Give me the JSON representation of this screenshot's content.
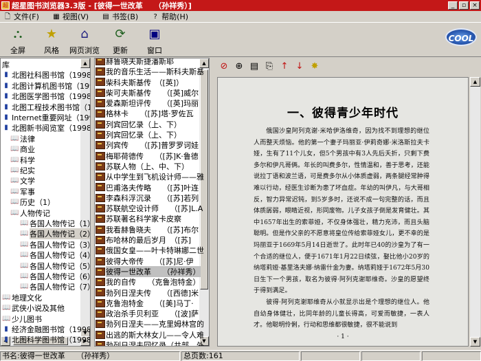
{
  "window": {
    "title": "超星图书浏览器3.3版 - [彼得一世改革　　（孙祥秀）]",
    "app_icon": "超",
    "min": "_",
    "restore": "▫",
    "close": "×"
  },
  "menu": [
    {
      "label": "文件(F)",
      "icon": "file-icon",
      "glyph": "🗋"
    },
    {
      "label": "视图(V)",
      "icon": "view-icon",
      "glyph": "▦"
    },
    {
      "label": "书签(B)",
      "icon": "bookmark-icon",
      "glyph": "▤"
    },
    {
      "label": "帮助(H)",
      "icon": "help-icon",
      "glyph": "?"
    }
  ],
  "toolbar": [
    {
      "label": "全屏",
      "icon": "fullscreen-icon",
      "glyph": "⛬",
      "color": "#206020"
    },
    {
      "label": "风格",
      "icon": "style-icon",
      "glyph": "★",
      "color": "#c0a000"
    },
    {
      "label": "网页浏览",
      "icon": "home-icon",
      "glyph": "⌂",
      "color": "#202080"
    },
    {
      "label": "更新",
      "icon": "update-icon",
      "glyph": "⟳",
      "color": "#206020"
    },
    {
      "label": "窗口",
      "icon": "window-icon",
      "glyph": "▣",
      "color": "#000080"
    }
  ],
  "logo": "COOL",
  "tree": [
    {
      "label": "库",
      "indent": 0,
      "icon": "none",
      "glyph": ""
    },
    {
      "label": "北图社科图书馆（1998.12.",
      "indent": 0,
      "icon": "library-icon",
      "glyph": "▮"
    },
    {
      "label": "北图计算机图书馆（1998.1",
      "indent": 0,
      "icon": "library-icon",
      "glyph": "▮"
    },
    {
      "label": "北图医学图书馆（1998.12.",
      "indent": 0,
      "icon": "library-icon",
      "glyph": "▮"
    },
    {
      "label": "北图工程技术图书馆（1998",
      "indent": 0,
      "icon": "library-icon",
      "glyph": "▮"
    },
    {
      "label": "Internet重要网址（1998.1",
      "indent": 0,
      "icon": "library-icon",
      "glyph": "▮"
    },
    {
      "label": "北图新书阅览室（1998.12.",
      "indent": 0,
      "icon": "library-icon",
      "glyph": "▮"
    },
    {
      "label": "法律",
      "indent": 1,
      "icon": "book-icon",
      "glyph": "📖"
    },
    {
      "label": "商业",
      "indent": 1,
      "icon": "book-icon",
      "glyph": "📖"
    },
    {
      "label": "科学",
      "indent": 1,
      "icon": "book-icon",
      "glyph": "📖"
    },
    {
      "label": "纪实",
      "indent": 1,
      "icon": "book-icon",
      "glyph": "📖"
    },
    {
      "label": "文学",
      "indent": 1,
      "icon": "book-icon",
      "glyph": "📖"
    },
    {
      "label": "军事",
      "indent": 1,
      "icon": "book-icon",
      "glyph": "📖"
    },
    {
      "label": "历史（1）",
      "indent": 1,
      "icon": "book-icon",
      "glyph": "📖"
    },
    {
      "label": "人物传记",
      "indent": 1,
      "icon": "book-icon",
      "glyph": "📖"
    },
    {
      "label": "各国人物传记（1）",
      "indent": 2,
      "icon": "book-icon",
      "glyph": "📖"
    },
    {
      "label": "各国人物传记（2）",
      "indent": 2,
      "icon": "book-icon",
      "glyph": "📖",
      "selected": true
    },
    {
      "label": "各国人物传记（3）",
      "indent": 2,
      "icon": "book-icon",
      "glyph": "📖"
    },
    {
      "label": "各国人物传记（4）",
      "indent": 2,
      "icon": "book-icon",
      "glyph": "📖"
    },
    {
      "label": "各国人物传记（5）",
      "indent": 2,
      "icon": "book-icon",
      "glyph": "📖"
    },
    {
      "label": "各国人物传记（6）",
      "indent": 2,
      "icon": "book-icon",
      "glyph": "📖"
    },
    {
      "label": "各国人物传记（7）",
      "indent": 2,
      "icon": "book-icon",
      "glyph": "📖"
    },
    {
      "label": "地理文化",
      "indent": 0,
      "icon": "book-icon",
      "glyph": "📖"
    },
    {
      "label": "武侠小说及其他",
      "indent": 0,
      "icon": "book-icon",
      "glyph": "📖"
    },
    {
      "label": "少儿图书",
      "indent": 0,
      "icon": "book-icon",
      "glyph": "📖"
    },
    {
      "label": "经济金融图书馆（1998.01.",
      "indent": 0,
      "icon": "library-icon",
      "glyph": "▮"
    },
    {
      "label": "北图科学图书馆（1998.01.",
      "indent": 0,
      "icon": "library-icon",
      "glyph": "▮"
    },
    {
      "label": "拨1",
      "indent": 0,
      "icon": "none",
      "glyph": ""
    }
  ],
  "books": [
    "赫鲁晓夫斯捷潘斯耶",
    "我的音乐生活——斯科夫斯基",
    "柴科夫斯基传　（[英]）",
    "柴可夫斯基传　　（[英]威尔",
    "爱森斯坦评传　　（[英]玛丽",
    "格林卡　　（[苏]塔·罗佐瓦",
    "列宾回忆录（上、下）",
    "列宾回忆录（上、下）",
    "列宾传　　（[苏]普罗罗诃娃",
    "梅耶荷德传　　（[苏]K·鲁德",
    "苏联人物（上、中、下）",
    "从中学生到飞机设计师——雅",
    "巴甫洛夫传略　　（[苏]叶连",
    "李森科浮沉录　　（[苏]若列",
    "苏联航空设计师　　（[苏]L.A",
    "苏联著名科学家卡皮察",
    "我看赫鲁晓夫　　（[苏]布尔",
    "布哈林的最后岁月　（[苏]",
    "俄国女皇——叶卡特琳娜二世",
    "彼得大帝传　　（[苏]尼·伊",
    "彼得一世改革　　（孙祥秀）",
    "我的自传　　（克鲁泡特金）",
    "勃列日涅夫传　　（[西德]米",
    "克鲁泡特金　　（[美]马丁·",
    "政治杀手贝利亚　　（[波]萨",
    "勃列日涅夫——克里姆林宫的",
    "出逃的斯大林女儿——令人难",
    "勃列日涅夫回忆录（共部，外"
  ],
  "selected_book_index": 20,
  "reader_tools": [
    {
      "icon": "stop-icon",
      "glyph": "⊘",
      "color": "#c01010"
    },
    {
      "icon": "zoom-icon",
      "glyph": "⊕",
      "color": "#000"
    },
    {
      "icon": "page-icon",
      "glyph": "▤",
      "color": "#000"
    },
    {
      "icon": "copy-icon",
      "glyph": "⎘",
      "color": "#000"
    },
    {
      "icon": "up-arrow-icon",
      "glyph": "↑",
      "color": "#c01010"
    },
    {
      "icon": "down-arrow-icon",
      "glyph": "↓",
      "color": "#c01010"
    },
    {
      "icon": "bookmark-star-icon",
      "glyph": "✸",
      "color": "#c0a000"
    }
  ],
  "page": {
    "chapter": "一、彼得青少年时代",
    "paragraphs": [
      "俄国沙皇阿列克谢·米哈伊洛维奇，因为找不到理想的继位人而整天烦恼。他的第一个妻子玛丽亚·伊莉奇娜·米洛斯拉夫卡娅，生有了11个儿女，但5个男孩中有3人先后夭折，只剩下费多尔和伊凡哥俩。年长的叫费多尔，性情温和，善于思考，还能说拉丁语和波兰语，可是费多尔从小体质虚弱，两条腿经常肿得难以行动，经医生诊断为患了坏血症。年幼的叫伊凡，与大哥相反，智力异常迟钝，到5岁多时，还说不成一句完整的话，而且体质孱弱，眼睛近视，形同废物。儿子女孩子倒是发育健壮。其中1657年出生的索菲娅，不仅身体强壮，精力充沛，而且头脑聪明。但是作父亲的不愿意将皇位传给索菲娅女儿，更不幸的是玛丽亚于1669年5月14日逝世了。此时年已40的沙皇为了有一个合适的继位人，便于1671年1月22日续弦，娶比他小20岁的纳塔莉娅·基里洛夫娜·纳雷什金为妻。纳塔莉娅于1672年5月30日生下一个男孩，取名为彼得·阿列克谢耶维奇。沙皇的愿望终于得到满足。",
      "彼得·阿列克谢耶维奇从小就显示出是个理想的继位人。他自幼身体健壮，比同年龄的儿童长得高，可爱而敏捷，一表人才。他聪明伶俐，行动和思维都很敏捷，很不能说到"
    ],
    "page_number": "· 1 ·"
  },
  "status": {
    "book": "书名:彼得一世改革　　（孙祥秀）",
    "pages": "总页数:161",
    "extra1": "",
    "extra2": ""
  },
  "colors": {
    "title_bg": "#c41818",
    "paper": "#e6e6e2"
  }
}
